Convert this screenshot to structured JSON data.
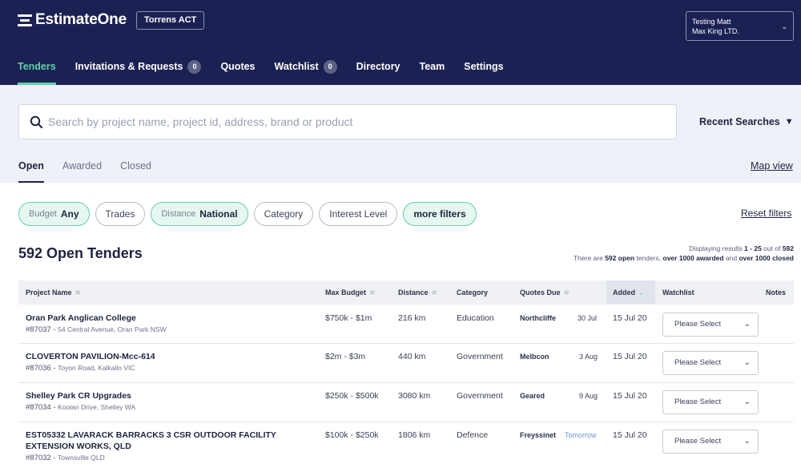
{
  "header": {
    "logo_text": "EstimateOne",
    "location": "Torrens ACT",
    "account": {
      "name": "Testing Matt",
      "company": "Max King LTD."
    },
    "nav": [
      {
        "label": "Tenders",
        "active": true
      },
      {
        "label": "Invitations & Requests",
        "count": "0"
      },
      {
        "label": "Quotes"
      },
      {
        "label": "Watchlist",
        "count": "0"
      },
      {
        "label": "Directory"
      },
      {
        "label": "Team"
      },
      {
        "label": "Settings"
      }
    ]
  },
  "search": {
    "placeholder": "Search by project name, project id, address, brand or product",
    "recent_label": "Recent Searches"
  },
  "subtabs": [
    "Open",
    "Awarded",
    "Closed"
  ],
  "map_view": "Map view",
  "filters": {
    "budget": {
      "key": "Budget",
      "value": "Any"
    },
    "trades": "Trades",
    "distance": {
      "key": "Distance",
      "value": "National"
    },
    "category": "Category",
    "interest": "Interest Level",
    "more": "more filters",
    "reset": "Reset filters"
  },
  "summary": {
    "title": "592 Open Tenders",
    "displaying_prefix": "Displaying results ",
    "displaying_range": "1 - 25",
    "displaying_mid": " out of ",
    "displaying_total": "592",
    "line2_a": "There are ",
    "line2_open": "592 open",
    "line2_b": " tenders, ",
    "line2_awarded": "over 1000 awarded",
    "line2_c": " and ",
    "line2_closed": "over 1000 closed"
  },
  "table": {
    "columns": {
      "project": "Project Name",
      "budget": "Max Budget",
      "distance": "Distance",
      "category": "Category",
      "quotes_due": "Quotes Due",
      "added": "Added",
      "watchlist": "Watchlist",
      "notes": "Notes"
    },
    "rows": [
      {
        "name": "Oran Park Anglican College",
        "id": "#87037",
        "address": "54 Central Avenue, Oran Park NSW",
        "budget": "$750k - $1m",
        "distance": "216 km",
        "category": "Education",
        "builder": "Northcliffe",
        "due": "30 Jul",
        "added": "15 Jul 20",
        "watch": "Please Select"
      },
      {
        "name": "CLOVERTON PAVILION-Mcc-614",
        "id": "#87036",
        "address": "Toyon Road, Kalkallo VIC",
        "budget": "$2m - $3m",
        "distance": "440 km",
        "category": "Government",
        "builder": "Melbcon",
        "due": "3 Aug",
        "added": "15 Jul 20",
        "watch": "Please Select"
      },
      {
        "name": "Shelley Park CR Upgrades",
        "id": "#87034",
        "address": "Koolan Drive, Shelley WA",
        "budget": "$250k - $500k",
        "distance": "3080 km",
        "category": "Government",
        "builder": "Geared",
        "due": "9 Aug",
        "added": "15 Jul 20",
        "watch": "Please Select"
      },
      {
        "name_line1": "EST05332 LAVARACK BARRACKS 3 CSR OUTDOOR FACILITY",
        "name_line2": "EXTENSION WORKS, QLD",
        "id": "#87032",
        "address": "Townsville QLD",
        "budget": "$100k - $250k",
        "distance": "1806 km",
        "category": "Defence",
        "builder": "Freyssinet",
        "due": "Tomorrow",
        "added": "15 Jul 20",
        "watch": "Please Select"
      }
    ]
  }
}
